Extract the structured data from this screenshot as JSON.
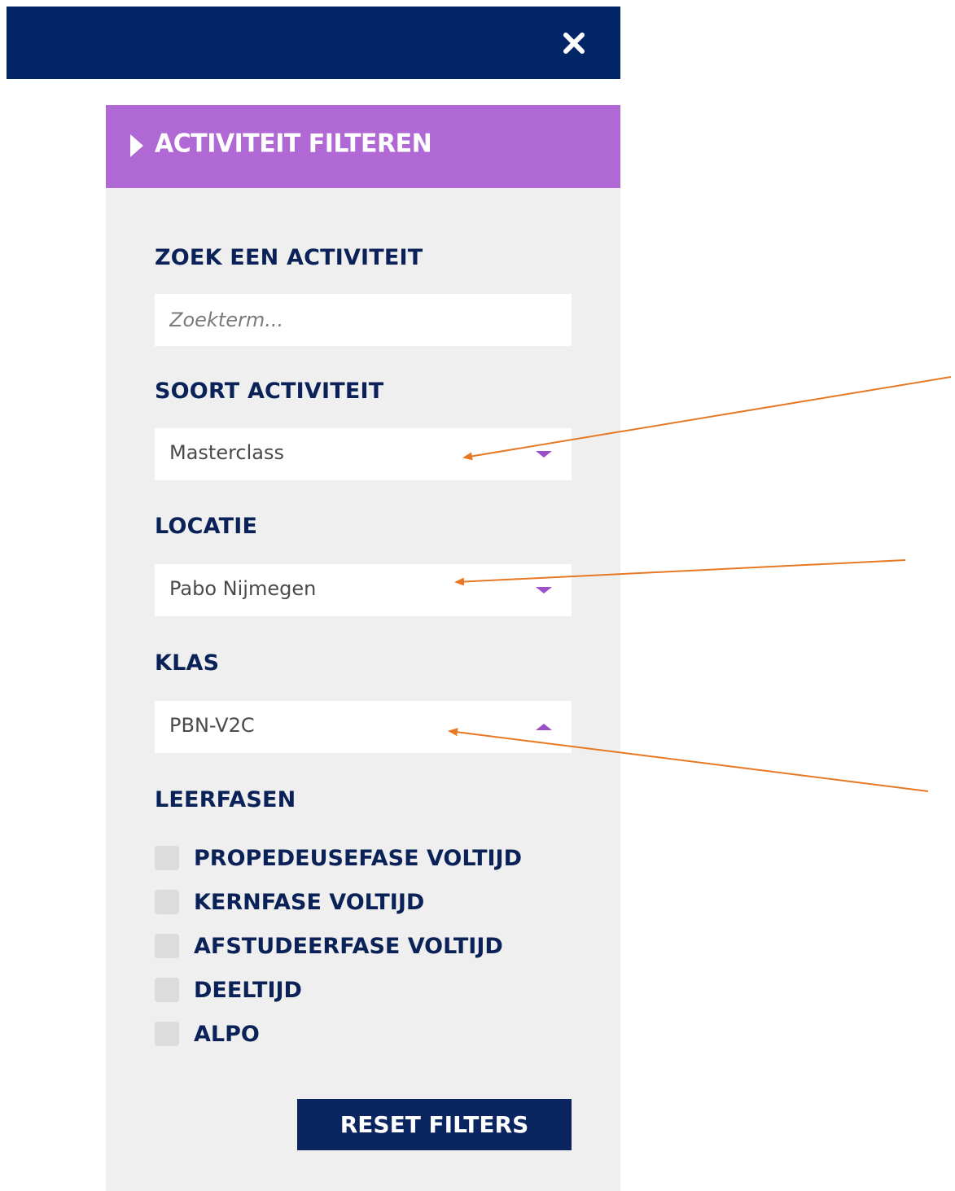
{
  "header": {
    "close_icon": "close-icon"
  },
  "panel": {
    "title": "ACTIVITEIT FILTEREN",
    "search": {
      "label": "ZOEK EEN ACTIVITEIT",
      "value": "",
      "placeholder": "Zoekterm..."
    },
    "activity_type": {
      "label": "SOORT ACTIVITEIT",
      "selected": "Masterclass"
    },
    "location": {
      "label": "LOCATIE",
      "selected": "Pabo Nijmegen"
    },
    "class": {
      "label": "KLAS",
      "selected": "PBN-V2C"
    },
    "phases": {
      "label": "LEERFASEN",
      "items": [
        {
          "label": "PROPEDEUSEFASE VOLTIJD",
          "checked": false
        },
        {
          "label": "KERNFASE VOLTIJD",
          "checked": false
        },
        {
          "label": "AFSTUDEERFASE VOLTIJD",
          "checked": false
        },
        {
          "label": "DEELTIJD",
          "checked": false
        },
        {
          "label": "ALPO",
          "checked": false
        }
      ]
    },
    "reset_label": "RESET FILTERS"
  },
  "colors": {
    "navy": "#012567",
    "purple": "#b069d4",
    "panel_bg": "#efefef",
    "annotation_arrow": "#e87722"
  }
}
